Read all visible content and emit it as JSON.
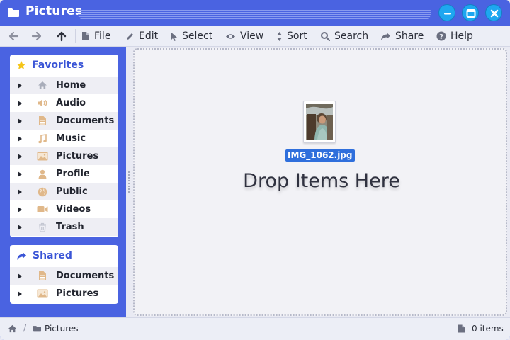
{
  "window": {
    "title": "Pictures",
    "accent": "#4a63e1",
    "control_color": "#1ea7f0"
  },
  "toolbar": {
    "nav": [
      "back-arrow",
      "forward-arrow",
      "up-arrow"
    ],
    "items": [
      {
        "label": "File",
        "icon": "file-icon"
      },
      {
        "label": "Edit",
        "icon": "pencil-icon"
      },
      {
        "label": "Select",
        "icon": "cursor-icon"
      },
      {
        "label": "View",
        "icon": "eye-icon"
      },
      {
        "label": "Sort",
        "icon": "sort-icon"
      },
      {
        "label": "Search",
        "icon": "search-icon"
      },
      {
        "label": "Share",
        "icon": "share-icon"
      },
      {
        "label": "Help",
        "icon": "help-icon"
      }
    ]
  },
  "sidebar": {
    "favorites": {
      "title": "Favorites",
      "items": [
        {
          "label": "Home",
          "icon": "home-icon"
        },
        {
          "label": "Audio",
          "icon": "speaker-icon"
        },
        {
          "label": "Documents",
          "icon": "document-icon"
        },
        {
          "label": "Music",
          "icon": "music-icon"
        },
        {
          "label": "Pictures",
          "icon": "picture-icon"
        },
        {
          "label": "Profile",
          "icon": "person-icon"
        },
        {
          "label": "Public",
          "icon": "globe-icon"
        },
        {
          "label": "Videos",
          "icon": "video-icon"
        },
        {
          "label": "Trash",
          "icon": "trash-icon"
        }
      ]
    },
    "shared": {
      "title": "Shared",
      "items": [
        {
          "label": "Documents",
          "icon": "document-icon"
        },
        {
          "label": "Pictures",
          "icon": "picture-icon"
        }
      ]
    }
  },
  "main": {
    "file": {
      "name": "IMG_1062.jpg"
    },
    "drop_message": "Drop Items Here"
  },
  "statusbar": {
    "path": [
      "Pictures"
    ],
    "count": "0 items"
  }
}
